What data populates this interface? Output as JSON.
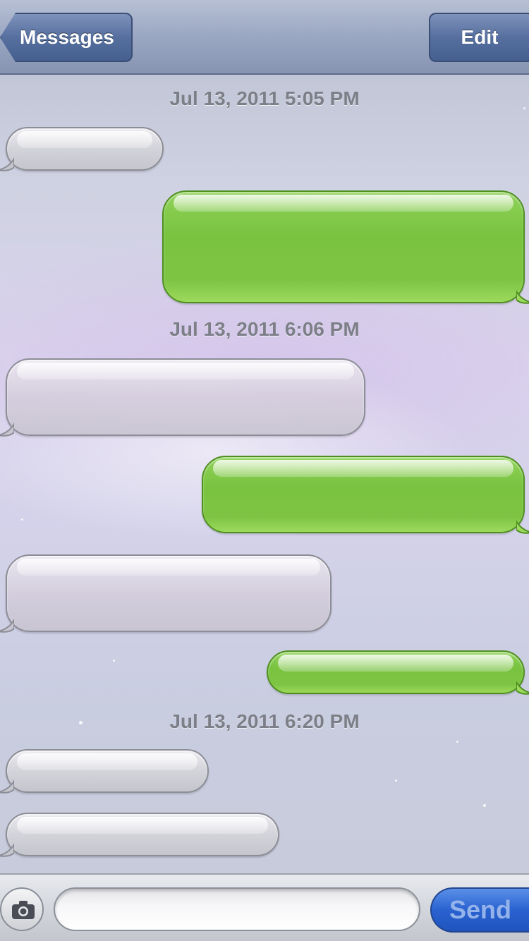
{
  "navbar": {
    "back_label": "Messages",
    "edit_label": "Edit"
  },
  "timestamps": [
    "Jul 13, 2011 5:05 PM",
    "Jul 13, 2011 6:06 PM",
    "Jul 13, 2011 6:20 PM"
  ],
  "messages": [
    {
      "direction": "received",
      "text": ""
    },
    {
      "direction": "sent",
      "text": ""
    },
    {
      "direction": "received",
      "text": ""
    },
    {
      "direction": "sent",
      "text": ""
    },
    {
      "direction": "received",
      "text": ""
    },
    {
      "direction": "sent",
      "text": ""
    },
    {
      "direction": "received",
      "text": ""
    },
    {
      "direction": "received",
      "text": ""
    }
  ],
  "composer": {
    "camera_icon": "camera-icon",
    "input_value": "",
    "send_label": "Send"
  },
  "colors": {
    "sent_bubble": "#7ec443",
    "received_bubble": "#d3d3da",
    "send_button": "#2a62d0",
    "navbar": "#9aa7c2"
  }
}
